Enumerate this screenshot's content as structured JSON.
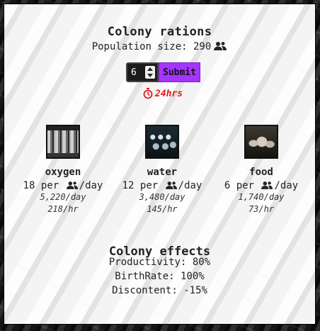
{
  "title": "Colony rations",
  "population": {
    "label": "Population size: 290",
    "icon": "people-icon"
  },
  "form": {
    "quantity": "6",
    "submit_label": "Submit",
    "accent": "#a534ff"
  },
  "timer": {
    "icon": "timer-icon",
    "label": "24hrs",
    "color": "#e01b1b"
  },
  "resources": [
    {
      "name": "oxygen",
      "rate_prefix": "18 per",
      "rate_suffix": "/day",
      "daily": "5,220/day",
      "hourly": "218/hr"
    },
    {
      "name": "water",
      "rate_prefix": "12 per",
      "rate_suffix": "/day",
      "daily": "3,480/day",
      "hourly": "145/hr"
    },
    {
      "name": "food",
      "rate_prefix": "6 per",
      "rate_suffix": "/day",
      "daily": "1,740/day",
      "hourly": "73/hr"
    }
  ],
  "effects": {
    "title": "Colony effects",
    "items": [
      "Productivity: 80%",
      "BirthRate: 100%",
      "Discontent: -15%"
    ]
  }
}
